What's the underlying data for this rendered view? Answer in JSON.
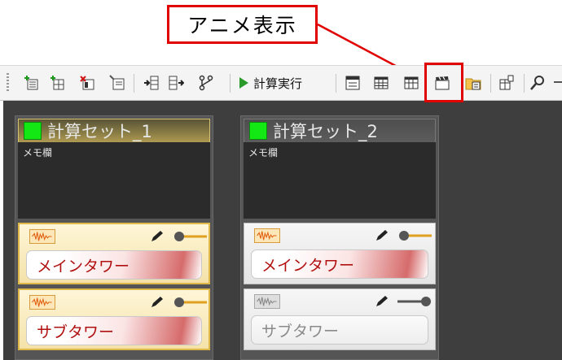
{
  "callout": {
    "label": "アニメ表示"
  },
  "toolbar": {
    "run_label": "計算実行",
    "icons": [
      "add-set-icon",
      "add-item-icon",
      "delete-icon",
      "edit-set-icon",
      "move-left-icon",
      "move-right-icon",
      "link-icon",
      "table-view-icon",
      "grid-view-icon",
      "grid-alt-view-icon",
      "animation-display-icon",
      "folder-chart-icon",
      "report-icon",
      "search-icon"
    ]
  },
  "panels": [
    {
      "title": "計算セット_1",
      "memo": "メモ欄",
      "towers": [
        {
          "name": "メインタワー",
          "enabled": true
        },
        {
          "name": "サブタワー",
          "enabled": true
        }
      ]
    },
    {
      "title": "計算セット_2",
      "memo": "メモ欄",
      "towers": [
        {
          "name": "メインタワー",
          "enabled": true
        },
        {
          "name": "サブタワー",
          "enabled": false
        }
      ]
    }
  ],
  "colors": {
    "callout_border": "#e00000",
    "set_indicator": "#14e814",
    "active_title": "#b09a52",
    "tower_text": "#b01010"
  }
}
